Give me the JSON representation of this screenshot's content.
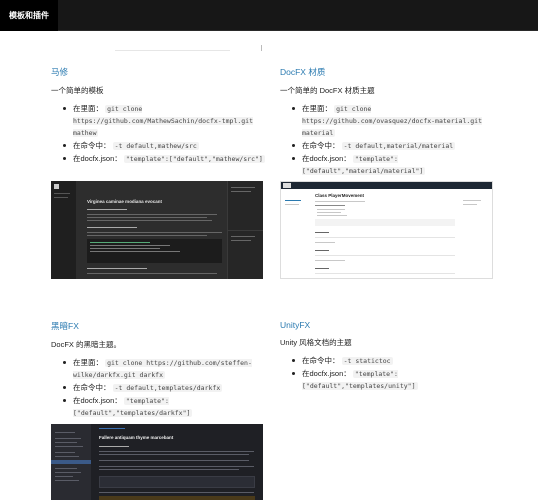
{
  "header": {
    "tab_label": "模板和插件"
  },
  "cards": [
    {
      "title": "马修",
      "desc": "一个简单的模板",
      "items": [
        {
          "prefix": "在里面：",
          "code": "git clone https://github.com/MathewSachin/docfx-tmpl.git mathew"
        },
        {
          "prefix": "在命令中：",
          "code": "-t default,mathew/src"
        },
        {
          "prefix": "在docfx.json：",
          "code": "\"template\":[\"default\",\"mathew/src\"]"
        }
      ],
      "screenshot_heading": "Virginea caminae modiana evocant"
    },
    {
      "title": "DocFX 材质",
      "desc": "一个简单的 DocFX 材质主题",
      "items": [
        {
          "prefix": "在里面：",
          "code": "git clone https://github.com/ovasquez/docfx-material.git material"
        },
        {
          "prefix": "在命令中：",
          "code": "-t default,material/material"
        },
        {
          "prefix": "在docfx.json：",
          "code": "\"template\":[\"default\",\"material/material\"]"
        }
      ],
      "screenshot_heading": "Class PlayerMovement"
    },
    {
      "title": "黑暗FX",
      "desc": "DocFX 的黑暗主题。",
      "items": [
        {
          "prefix": "在里面：",
          "code": "git clone https://github.com/steffen-wilke/darkfx.git darkfx"
        },
        {
          "prefix": "在命令中：",
          "code": "-t default,templates/darkfx"
        },
        {
          "prefix": "在docfx.json：",
          "code": "\"template\":[\"default\",\"templates/darkfx\"]"
        }
      ],
      "screenshot_heading": "Fallere antiquam thyme marcebant"
    },
    {
      "title": "UnityFX",
      "desc": "Unity 风格文档的主题",
      "items": [
        {
          "prefix": "在命令中：",
          "code": "-t statictoс"
        },
        {
          "prefix": "在docfx.json：",
          "code": "\"template\":[\"default\",\"templates/unity\"]"
        }
      ]
    }
  ]
}
